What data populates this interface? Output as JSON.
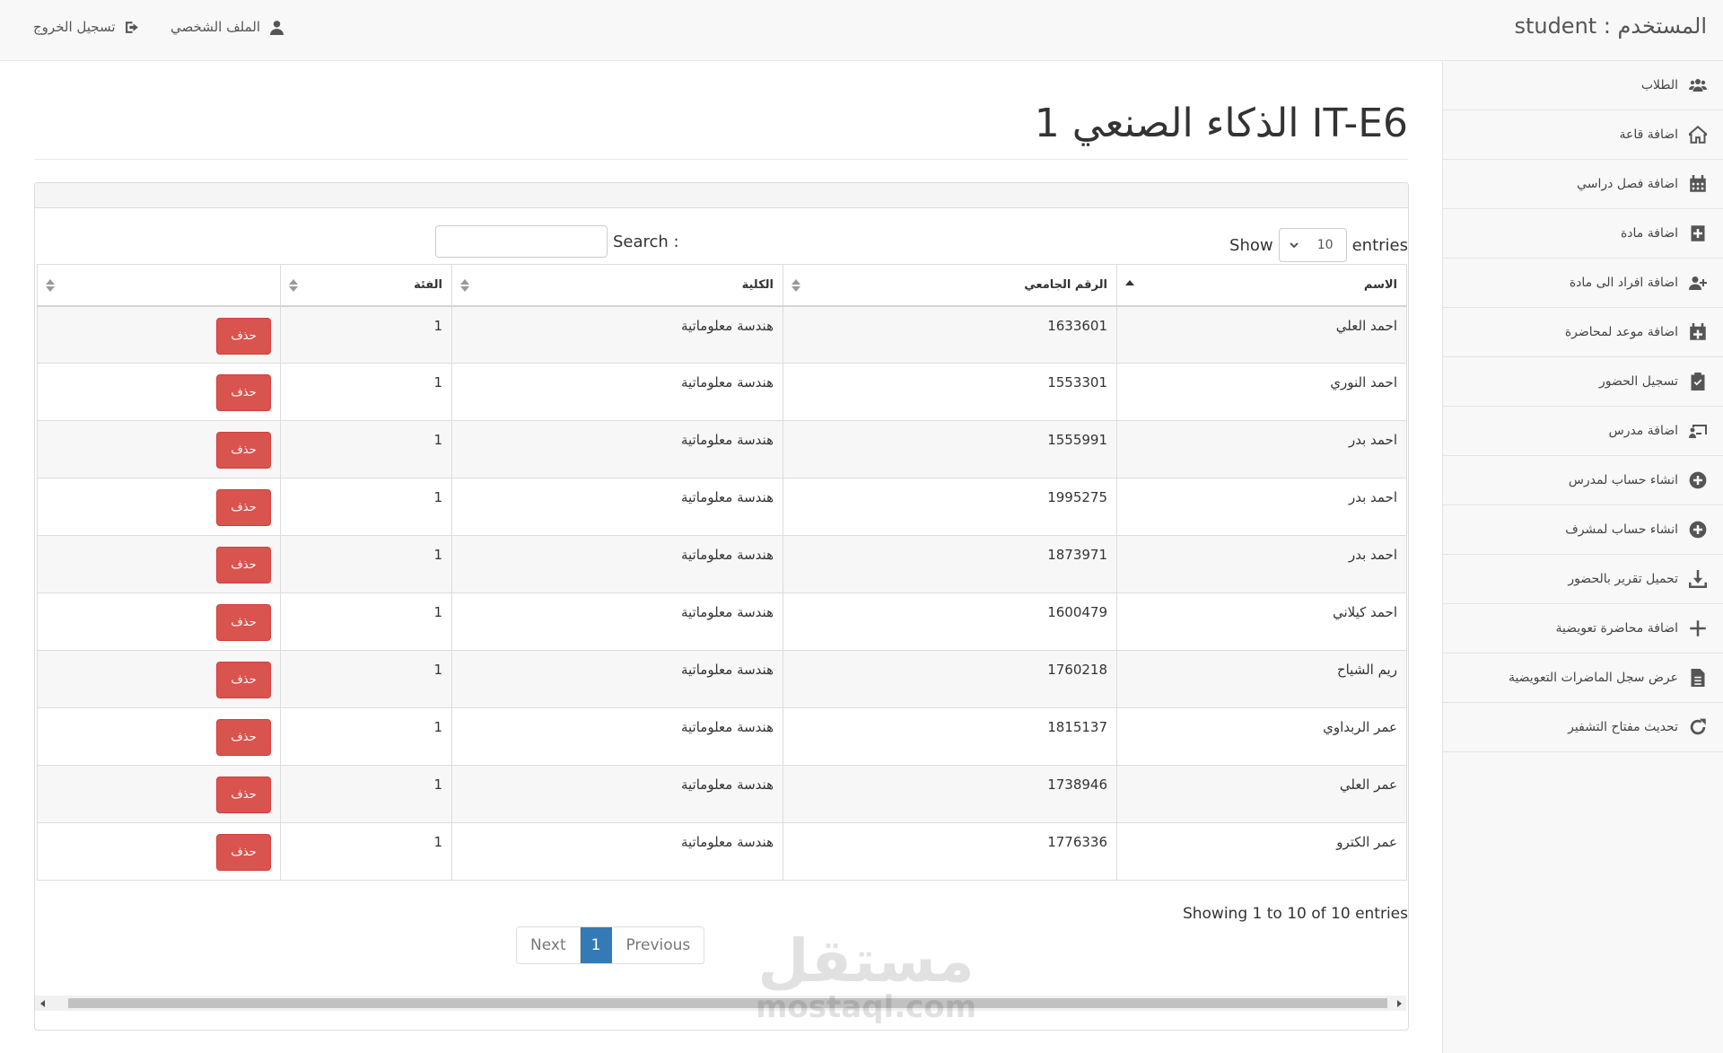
{
  "header": {
    "user_label": "المستخدم : student",
    "profile_label": "الملف الشخصي",
    "logout_label": "تسجيل الخروج"
  },
  "sidebar": {
    "items": [
      {
        "label": "الطلاب",
        "icon": "users-icon"
      },
      {
        "label": "اضافة قاعة",
        "icon": "home-icon"
      },
      {
        "label": "اضافة فصل دراسي",
        "icon": "calendar-icon"
      },
      {
        "label": "اضافة مادة",
        "icon": "book-plus-icon"
      },
      {
        "label": "اضافة افراد الى مادة",
        "icon": "user-plus-icon"
      },
      {
        "label": "اضافة موعد لمحاضرة",
        "icon": "calendar-plus-icon"
      },
      {
        "label": "تسجيل الحضور",
        "icon": "clipboard-check-icon"
      },
      {
        "label": "اضافة مدرس",
        "icon": "teacher-icon"
      },
      {
        "label": "انشاء حساب لمدرس",
        "icon": "plus-circle-icon"
      },
      {
        "label": "انشاء حساب لمشرف",
        "icon": "plus-circle-icon"
      },
      {
        "label": "تحميل تقرير بالحضور",
        "icon": "download-icon"
      },
      {
        "label": "اضافة محاضرة تعويضية",
        "icon": "plus-icon"
      },
      {
        "label": "عرض سجل الماضرات التعويضية",
        "icon": "file-icon"
      },
      {
        "label": "تحديث مفتاح التشفير",
        "icon": "refresh-icon"
      }
    ]
  },
  "main": {
    "title": "الذكاء الصنعي 1 IT-E6"
  },
  "table_controls": {
    "show_label": "Show",
    "entries_value": "10",
    "entries_label": "entries",
    "search_label": "Search :",
    "search_value": ""
  },
  "table": {
    "columns": [
      "الاسم",
      "الرقم الجامعي",
      "الكلية",
      "الفئة",
      ""
    ],
    "delete_label": "حذف",
    "rows": [
      {
        "name": "احمد العلي",
        "id": "1633601",
        "faculty": "هندسة معلوماتية",
        "category": "1"
      },
      {
        "name": "احمد النوري",
        "id": "1553301",
        "faculty": "هندسة معلوماتية",
        "category": "1"
      },
      {
        "name": "احمد بدر",
        "id": "1555991",
        "faculty": "هندسة معلوماتية",
        "category": "1"
      },
      {
        "name": "احمد بدر",
        "id": "1995275",
        "faculty": "هندسة معلوماتية",
        "category": "1"
      },
      {
        "name": "احمد بدر",
        "id": "1873971",
        "faculty": "هندسة معلوماتية",
        "category": "1"
      },
      {
        "name": "احمد كيلاني",
        "id": "1600479",
        "faculty": "هندسة معلوماتية",
        "category": "1"
      },
      {
        "name": "ريم الشياح",
        "id": "1760218",
        "faculty": "هندسة معلوماتية",
        "category": "1"
      },
      {
        "name": "عمر الربداوي",
        "id": "1815137",
        "faculty": "هندسة معلوماتية",
        "category": "1"
      },
      {
        "name": "عمر العلي",
        "id": "1738946",
        "faculty": "هندسة معلوماتية",
        "category": "1"
      },
      {
        "name": "عمر الكترو",
        "id": "1776336",
        "faculty": "هندسة معلوماتية",
        "category": "1"
      }
    ]
  },
  "pagination": {
    "info": "Showing 1 to 10 of 10 entries",
    "next_label": "Next",
    "current_page": "1",
    "previous_label": "Previous"
  },
  "watermark": {
    "arabic": "مستقل",
    "latin": "mostaql.com"
  },
  "colors": {
    "delete_button": "#d9534f",
    "active_page": "#337ab7"
  }
}
